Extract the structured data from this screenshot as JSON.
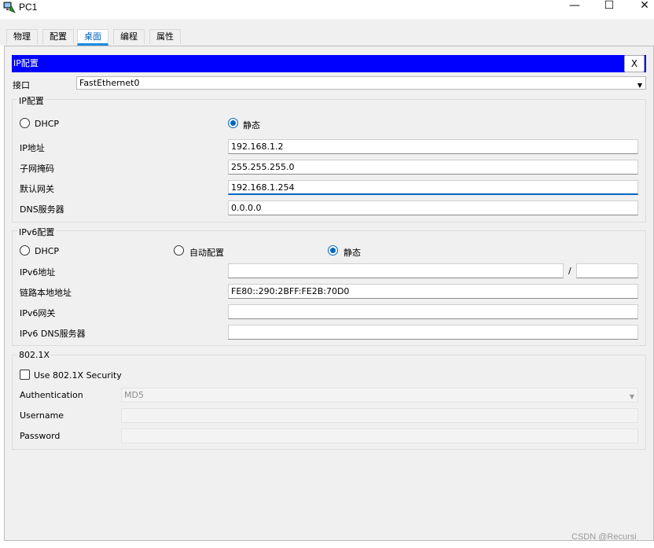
{
  "window": {
    "title": "PC1",
    "minimize": "—",
    "maximize": "☐",
    "close": "✕"
  },
  "tabs": [
    {
      "label": "物理"
    },
    {
      "label": "配置"
    },
    {
      "label": "桌面"
    },
    {
      "label": "编程"
    },
    {
      "label": "属性"
    }
  ],
  "active_tab": "桌面",
  "ipconfig": {
    "header": "IP配置",
    "close_label": "X",
    "interface_label": "接口",
    "interface_value": "FastEthernet0",
    "ipv4": {
      "group_title": "IP配置",
      "dhcp_label": "DHCP",
      "static_label": "静态",
      "mode": "static",
      "ip_label": "IP地址",
      "ip_value": "192.168.1.2",
      "mask_label": "子网掩码",
      "mask_value": "255.255.255.0",
      "gateway_label": "默认网关",
      "gateway_value": "192.168.1.254",
      "dns_label": "DNS服务器",
      "dns_value": "0.0.0.0"
    },
    "ipv6": {
      "group_title": "IPv6配置",
      "dhcp_label": "DHCP",
      "auto_label": "自动配置",
      "static_label": "静态",
      "mode": "static",
      "address_label": "IPv6地址",
      "address_value": "",
      "prefix_sep": "/",
      "prefix_value": "",
      "linklocal_label": "链路本地地址",
      "linklocal_value": "FE80::290:2BFF:FE2B:70D0",
      "gateway_label": "IPv6网关",
      "gateway_value": "",
      "dns_label": "IPv6 DNS服务器",
      "dns_value": ""
    },
    "dot1x": {
      "group_title": "802.1X",
      "use_label": "Use 802.1X Security",
      "use_checked": false,
      "auth_label": "Authentication",
      "auth_value": "MD5",
      "username_label": "Username",
      "username_value": "",
      "password_label": "Password",
      "password_value": ""
    }
  },
  "watermark": "CSDN @Recursi",
  "colors": {
    "header_bar": "#0000ff",
    "accent": "#0067c0"
  }
}
